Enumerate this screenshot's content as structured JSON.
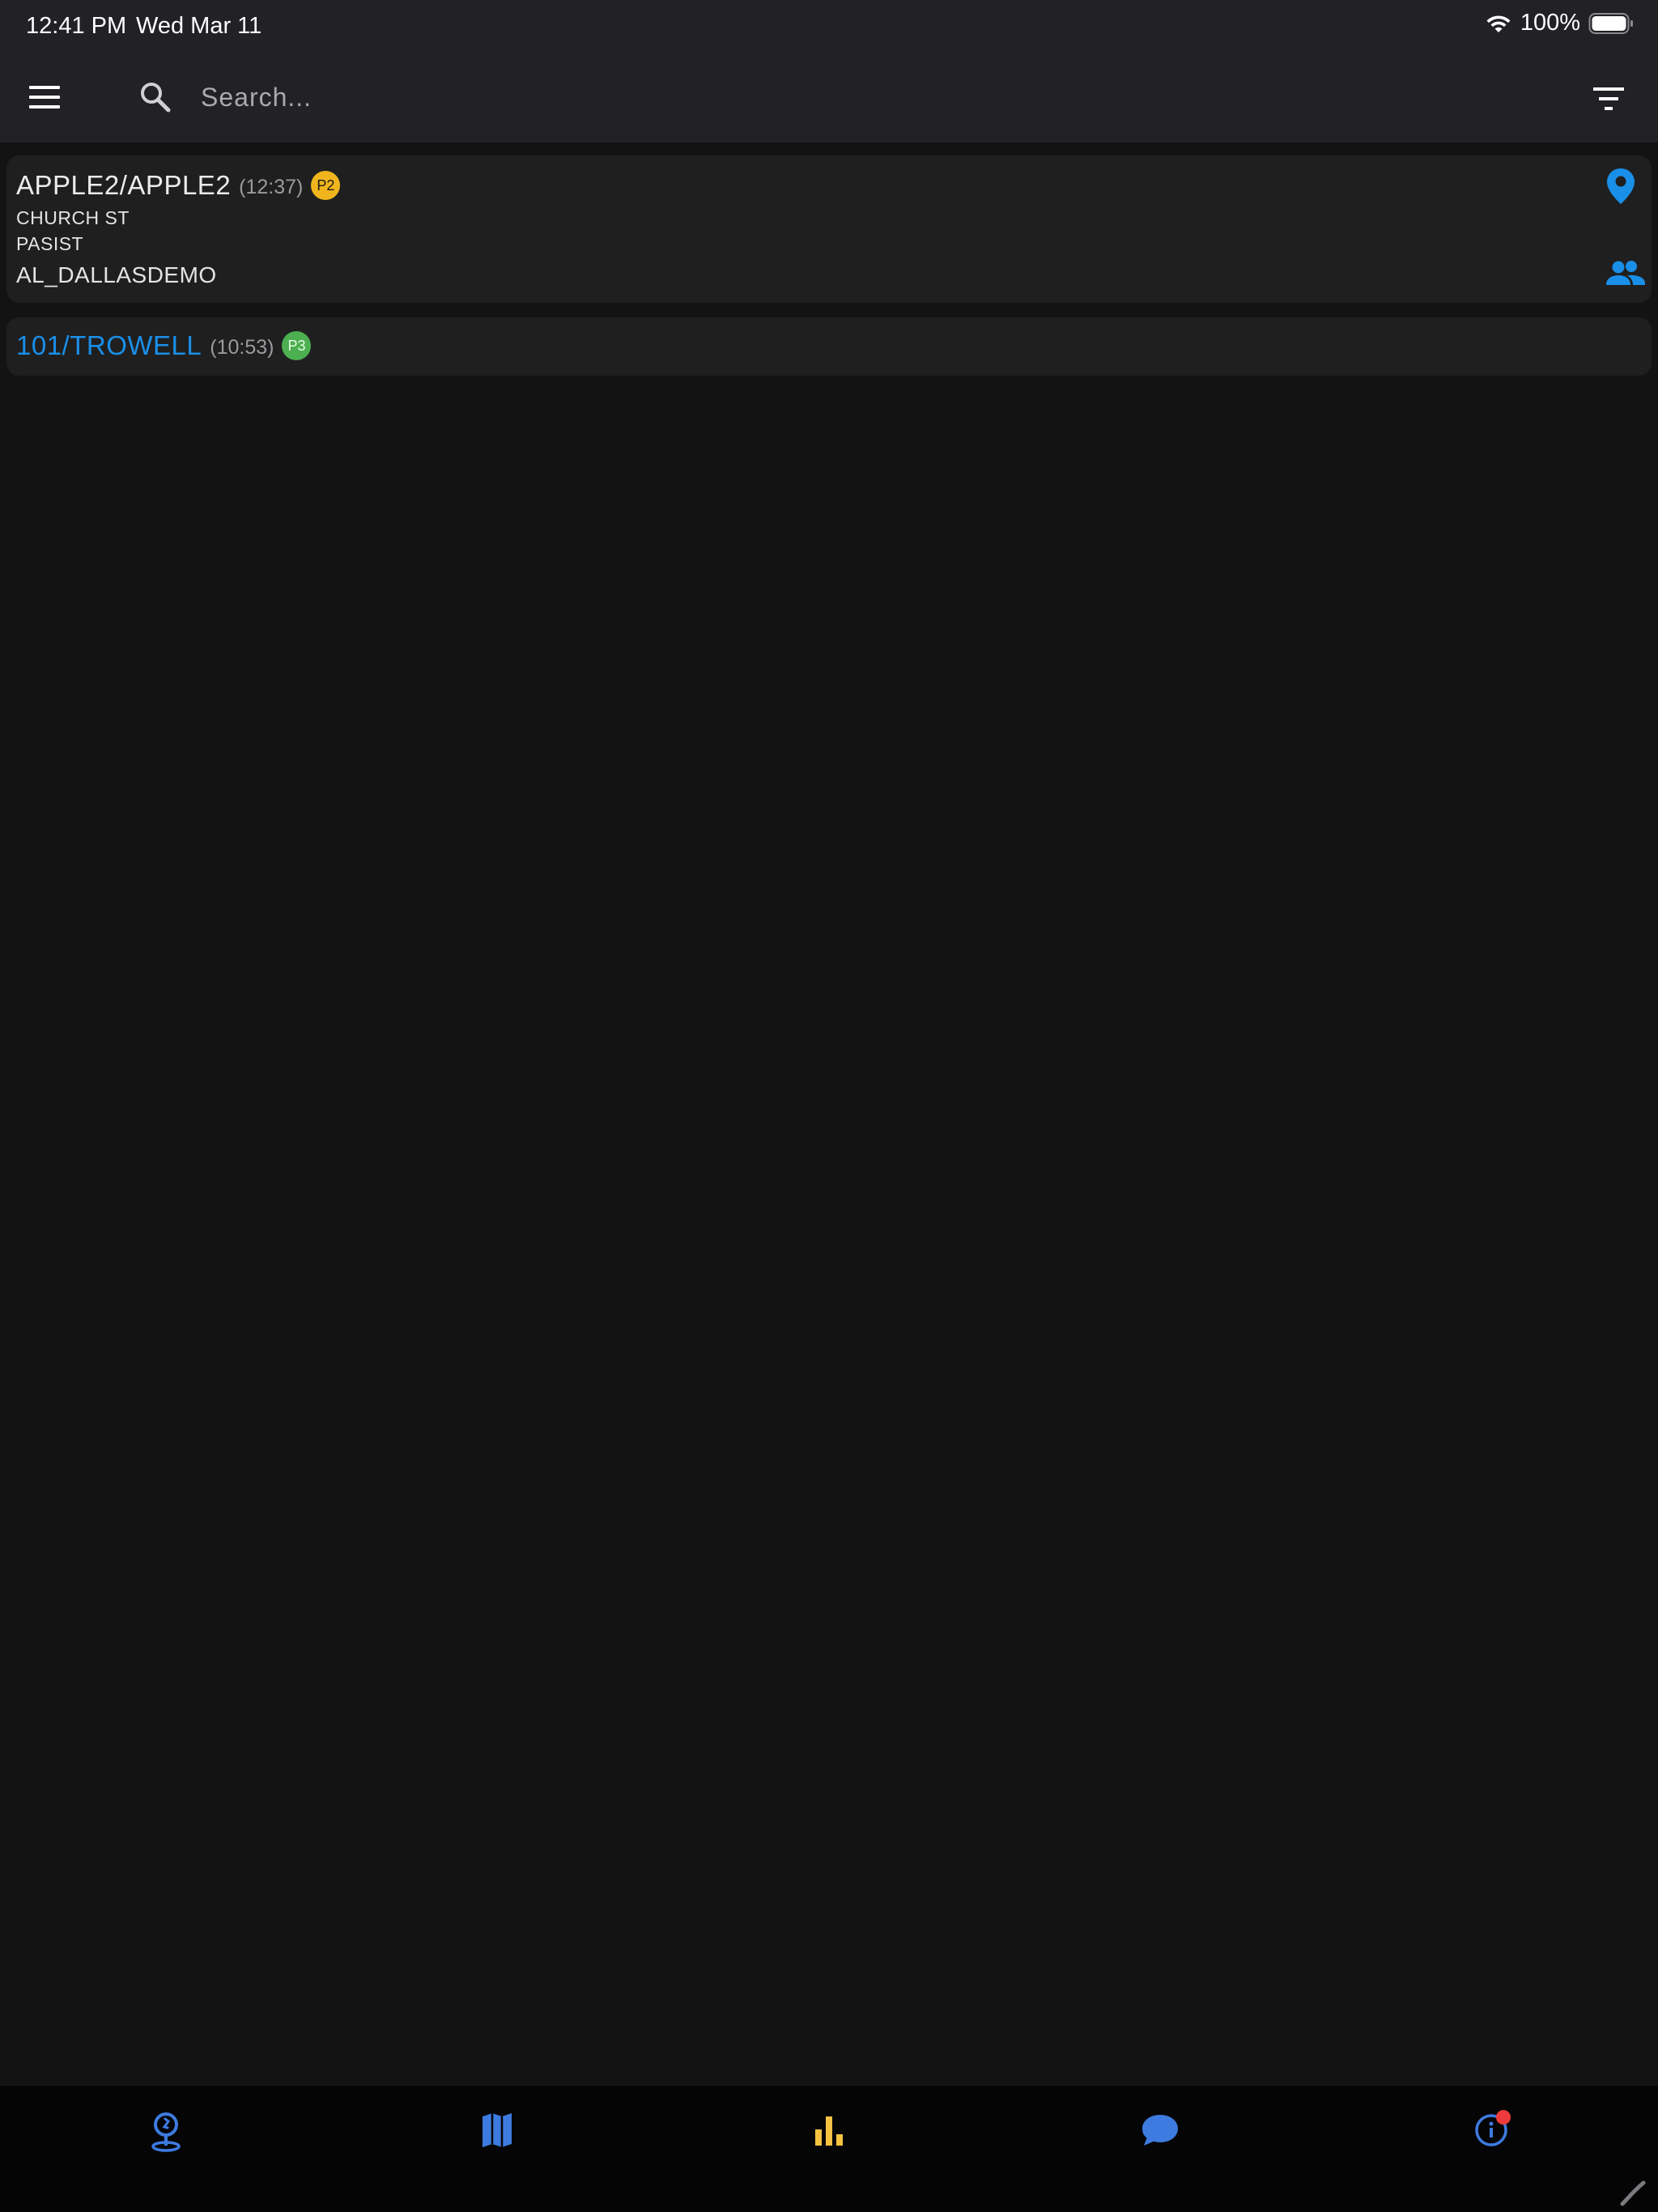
{
  "status_bar": {
    "time": "12:41 PM",
    "date": "Wed Mar 11",
    "battery": "100%"
  },
  "toolbar": {
    "search_placeholder": "Search...",
    "menu_icon": "hamburger-menu-icon",
    "search_icon": "search-icon",
    "filter_icon": "filter-icon"
  },
  "incidents": [
    {
      "title": "APPLE2/APPLE2",
      "time": "(12:37)",
      "priority": "P2",
      "priority_color": "#f0b51c",
      "title_color": "#ececee",
      "address": "CHURCH ST",
      "type": "PASIST",
      "agency": "AL_DALLASDEMO"
    },
    {
      "title": "101/TROWELL",
      "time": "(10:53)",
      "priority": "P3",
      "priority_color": "#4caf50",
      "title_color": "#1a8fe8"
    }
  ],
  "bottom_nav": {
    "items": [
      {
        "icon": "incident-location-icon",
        "color": "#3d7be0"
      },
      {
        "icon": "map-icon",
        "color": "#3d7be0"
      },
      {
        "icon": "bar-chart-icon",
        "color": "#f5c242"
      },
      {
        "icon": "chat-bubble-icon",
        "color": "#3d7be0"
      },
      {
        "icon": "info-icon",
        "color": "#3d7be0",
        "badge_color": "#ef3b3b"
      }
    ]
  },
  "colors": {
    "accent": "#1a8fe8",
    "background": "#131314",
    "toolbar": "#212126",
    "card": "#1f1f20"
  }
}
